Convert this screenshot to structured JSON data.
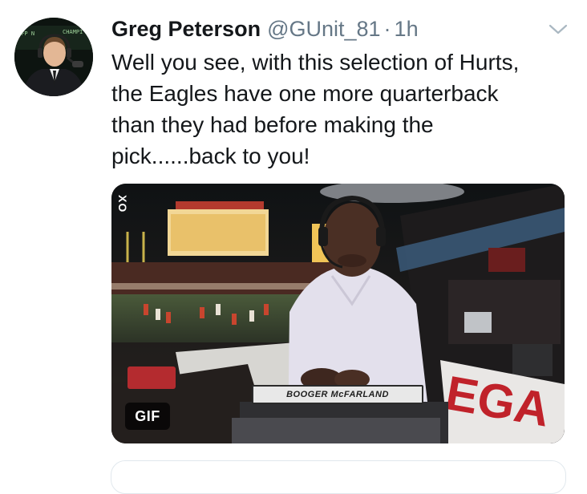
{
  "tweet": {
    "author_name": "Greg Peterson",
    "handle": "@GUnit_81",
    "separator": "·",
    "time": "1h",
    "text": "Well you see, with this selection of Hurts,\nthe Eagles have one more quarterback\nthan they had before making the\npick......back to you!",
    "avatar_icon": "avatar-photo",
    "menu_icon": "chevron-down-icon"
  },
  "media": {
    "type": "gif",
    "badge_label": "GIF",
    "network_bug": "XO",
    "nameplate": "BOOGER McFARLAND",
    "avatar_overlay": {
      "left_text": "CFP N",
      "right_text": "CHAMPI"
    }
  },
  "colors": {
    "text_primary": "#14171a",
    "text_secondary": "#657786",
    "border": "#e1e8ed",
    "background": "#ffffff"
  }
}
